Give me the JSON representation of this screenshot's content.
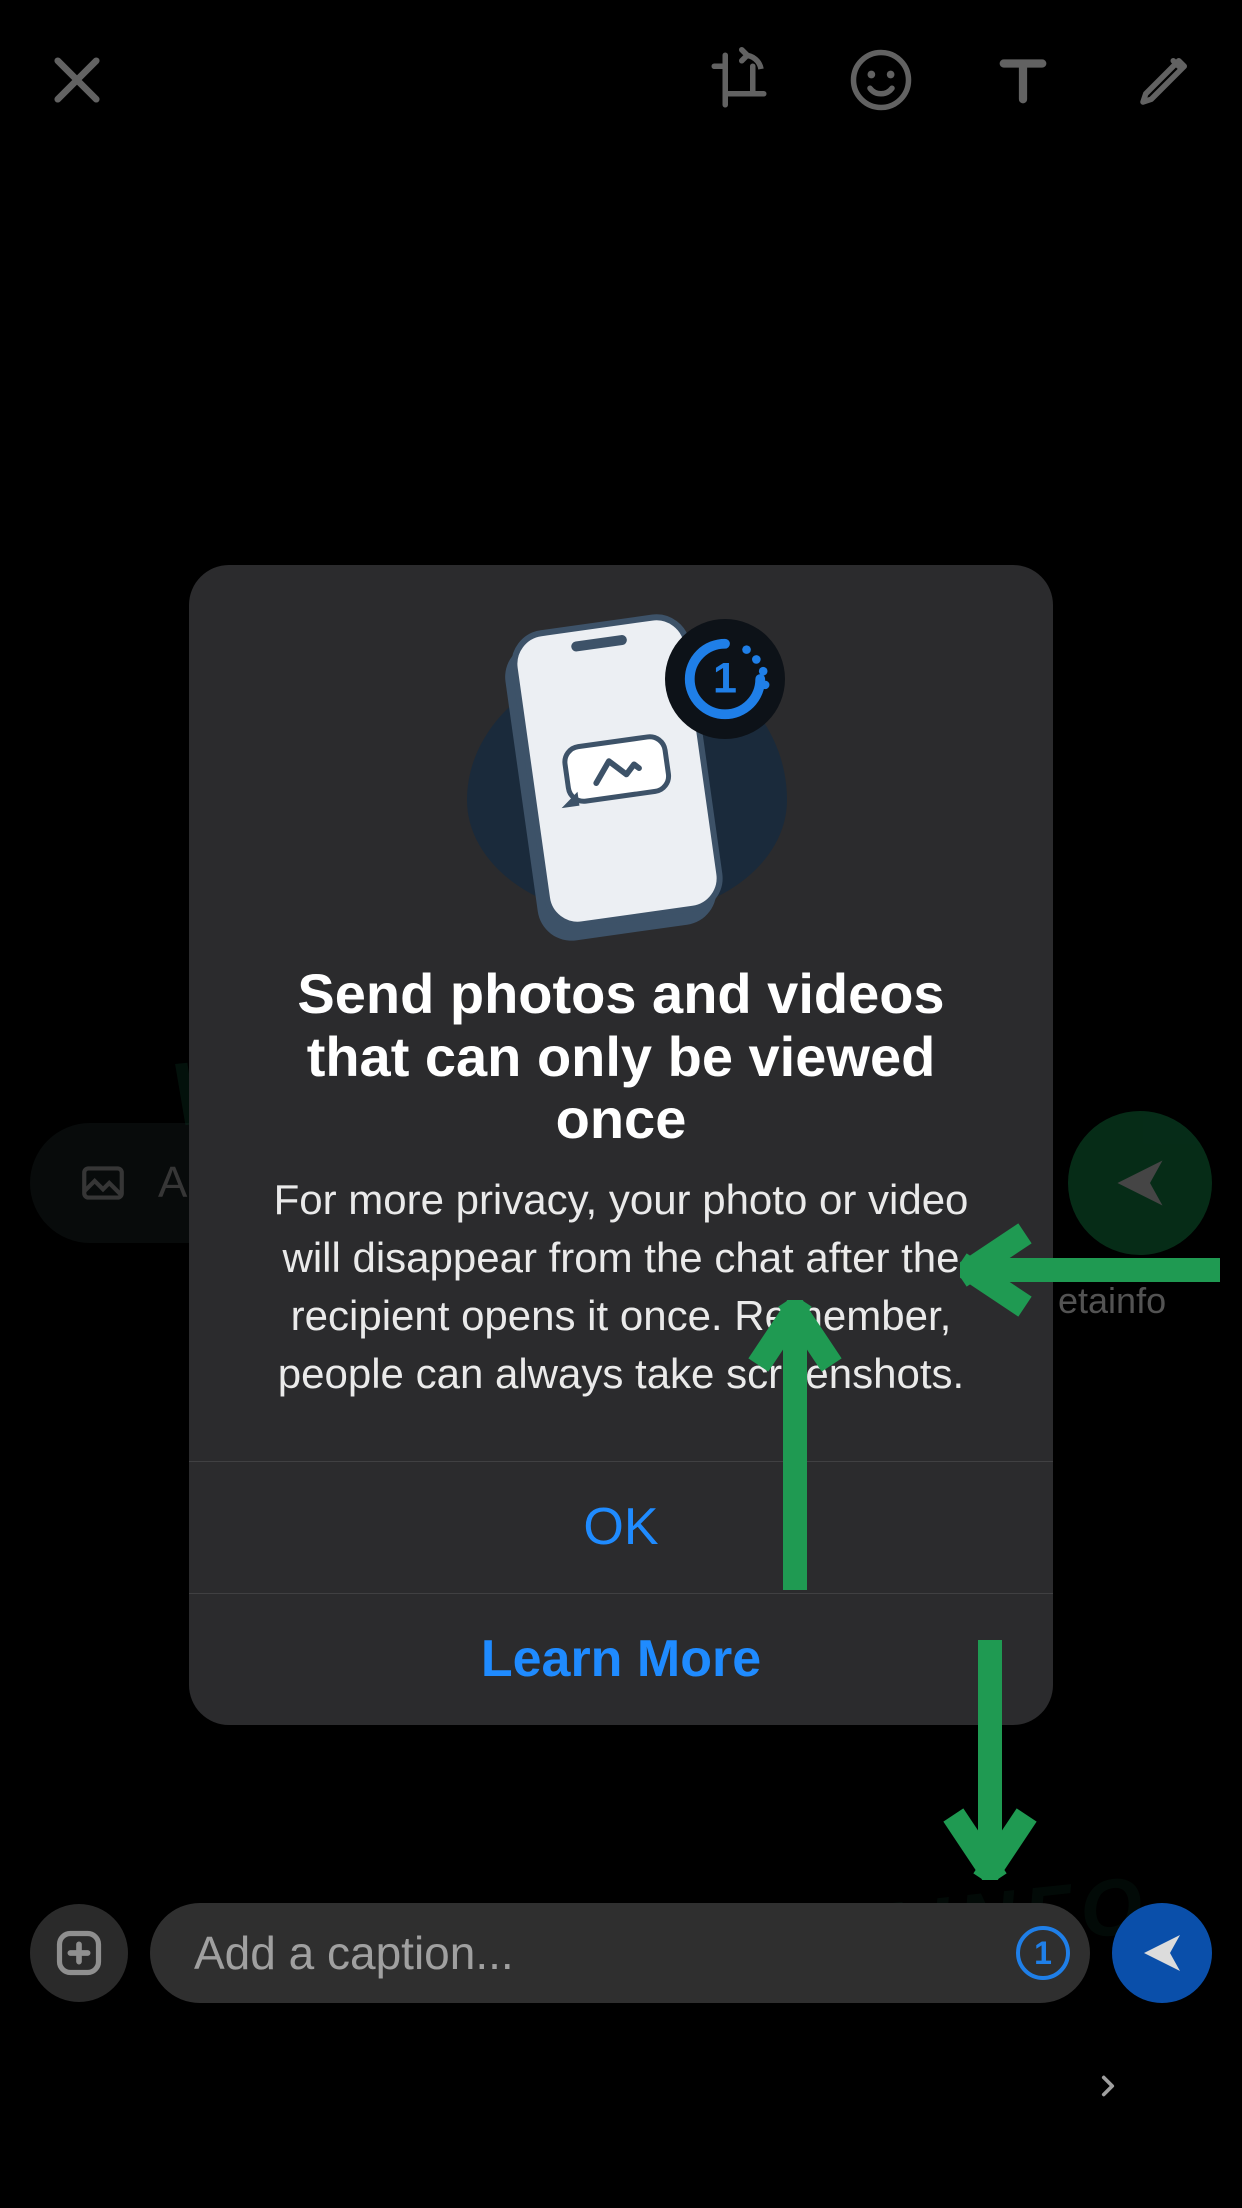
{
  "toolbar": {
    "close_icon": "close-icon",
    "crop_icon": "crop-rotate-icon",
    "emoji_icon": "emoji-icon",
    "text_icon": "text-tool-icon",
    "draw_icon": "pencil-icon"
  },
  "bg_caption": {
    "partial_text": "A",
    "send_icon": "send-icon"
  },
  "betainfo_fragment": "etainfo",
  "modal": {
    "title": "Send photos and videos that can only be viewed once",
    "body": "For more privacy, your photo or video will disappear from the chat after the recipient opens it once. Remember, people can always take screenshots.",
    "ok_label": "OK",
    "learn_more_label": "Learn More",
    "badge_number": "1"
  },
  "caption": {
    "placeholder": "Add a caption...",
    "view_once_badge": "1"
  },
  "watermarks": {
    "w1": "WABETAINFO",
    "w2": "WABETAINFO"
  },
  "colors": {
    "accent_blue": "#1f8bff",
    "send_green": "#18a558",
    "arrow_green": "#1f9a52",
    "send_blue": "#0a4faa"
  }
}
